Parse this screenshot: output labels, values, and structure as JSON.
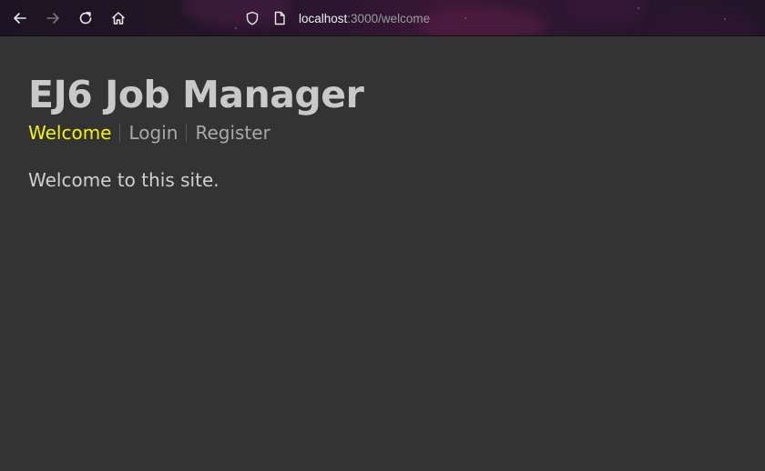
{
  "browser": {
    "url_host": "localhost",
    "url_rest": ":3000/welcome",
    "icons": [
      "back-arrow-icon",
      "forward-arrow-icon",
      "reload-icon",
      "home-icon",
      "shield-icon",
      "page-icon"
    ]
  },
  "site": {
    "title": "EJ6 Job Manager",
    "nav": [
      {
        "label": "Welcome",
        "active": true
      },
      {
        "label": "Login",
        "active": false
      },
      {
        "label": "Register",
        "active": false
      }
    ],
    "welcome_message": "Welcome to this site."
  },
  "colors": {
    "page_background": "#333333",
    "title": "#c9c9c9",
    "nav_link": "#a9a9a9",
    "nav_active": "#f2f21a",
    "body_text": "#cfcfcf"
  }
}
